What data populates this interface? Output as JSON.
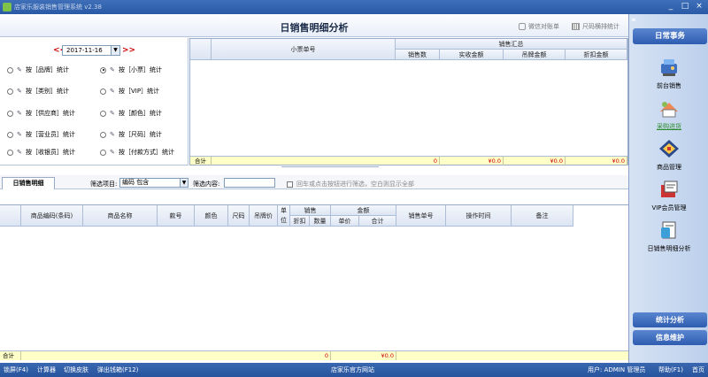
{
  "window": {
    "title": "店家乐服装销售管理系统 v2.38",
    "controls": [
      "_",
      "□",
      "×"
    ]
  },
  "header": {
    "title": "日销售明细分析",
    "actions": [
      {
        "icon": "wechat-icon",
        "label": "微信对账单"
      },
      {
        "icon": "barcode-icon",
        "label": "尺码横排统计"
      }
    ]
  },
  "date_picker": {
    "prev": "<<",
    "value": "2017-11-16",
    "next": ">>"
  },
  "options": [
    {
      "label": "按［品牌］统计",
      "checked": false
    },
    {
      "label": "按［小票］统计",
      "checked": true
    },
    {
      "label": "按［类别］统计",
      "checked": false
    },
    {
      "label": "按［VIP］统计",
      "checked": false
    },
    {
      "label": "按［供应商］统计",
      "checked": false
    },
    {
      "label": "按［颜色］统计",
      "checked": false
    },
    {
      "label": "按［营业员］统计",
      "checked": false
    },
    {
      "label": "按［尺码］统计",
      "checked": false
    },
    {
      "label": "按［收银员］统计",
      "checked": false
    },
    {
      "label": "按［付款方式］统计",
      "checked": false
    }
  ],
  "grid1": {
    "col_ticket": "小票单号",
    "group_label": "销售汇总",
    "sub_columns": [
      "销售数",
      "实收金额",
      "吊牌金额",
      "折扣金额"
    ],
    "total_label": "合计",
    "totals": [
      "0",
      "¥0.0",
      "¥0.0",
      "¥0.0"
    ]
  },
  "filter": {
    "tab_label": "日销售明细",
    "field_label": "筛选项目:",
    "field_value": "编码 包含",
    "content_label": "筛选内容:",
    "content_value": "",
    "hint": "回车或点击按钮进行筛选，空白则显示全部"
  },
  "grid2": {
    "columns": [
      "商品编码(条码)",
      "商品名称",
      "款号",
      "颜色",
      "尺码",
      "吊牌价"
    ],
    "unit_col": "单位",
    "sales_group": "销售",
    "sales_sub": [
      "折扣",
      "数量"
    ],
    "amount_group": "金额",
    "amount_sub": [
      "单价",
      "合计"
    ],
    "tail_columns": [
      "销售单号",
      "操作时间",
      "备注"
    ],
    "total_label": "合计",
    "total_qty": "0",
    "total_amount": "¥0.0"
  },
  "status": {
    "left": [
      "锁屏(F4)",
      "计算器",
      "切换皮肤",
      "弹出钱箱(F12)"
    ],
    "center": "店家乐官方网站",
    "user_label": "用户: ADMIN 管理员",
    "help": "帮助(F1)",
    "home": "首页"
  },
  "sidebar": {
    "collapse": "»",
    "heading": "日常事务",
    "items": [
      {
        "icon": "pos-icon",
        "label": "前台销售",
        "link": false
      },
      {
        "icon": "purchase-icon",
        "label": "采购进货",
        "link": true
      },
      {
        "icon": "product-icon",
        "label": "商品管理",
        "link": false
      },
      {
        "icon": "vip-icon",
        "label": "VIP会员管理",
        "link": false
      },
      {
        "icon": "report-icon",
        "label": "日销售明细分析",
        "link": false
      }
    ],
    "footer": [
      "统计分析",
      "信息维护"
    ]
  },
  "colors": {
    "titlebar": "#2a5aa6",
    "sidebar_head": "#2e5cb0",
    "total_row": "#ffffc8",
    "total_text": "#cc0000"
  }
}
